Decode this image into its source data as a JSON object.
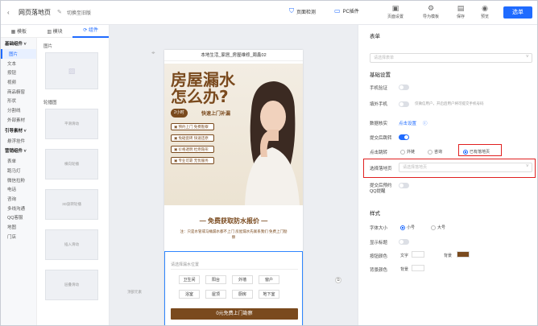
{
  "topbar": {
    "back_icon": "chevron-left-icon",
    "title": "网页落地页",
    "switch_label": "切换至旧版",
    "check_label": "页面检测",
    "pc_label": "PC插件",
    "actions": [
      {
        "label": "页面设置",
        "icon": "page-settings-icon"
      },
      {
        "label": "导为模板",
        "icon": "template-icon"
      },
      {
        "label": "保存",
        "icon": "save-icon"
      },
      {
        "label": "预览",
        "icon": "preview-icon"
      }
    ],
    "publish_label": "选单",
    "accent": "#1f6bff"
  },
  "left_panel": {
    "tabs": [
      "模板",
      "模块",
      "组件"
    ],
    "active_tab": "组件",
    "categories": [
      {
        "group": "基础组件",
        "items": [
          "图片",
          "文本",
          "按钮",
          "视频",
          "商品橱窗",
          "形状",
          "分割线",
          "外部素材"
        ]
      },
      {
        "group": "引导素材",
        "items": [
          "悬浮挂件"
        ]
      },
      {
        "group": "营销组件",
        "items": [
          "表单",
          "跑马灯",
          "微信拉粉",
          "电话",
          "咨询",
          "多线沟通",
          "QQ客服",
          "地图",
          "门店"
        ]
      }
    ],
    "active_item": "图片",
    "widgets": {
      "image_label": "图片",
      "carousel_label": "轮播图",
      "carousel_items": [
        "平滑滑动",
        "横向轮播",
        "3D旋转轮播",
        "插入滑动",
        "层叠滑动"
      ]
    }
  },
  "canvas": {
    "page_title": "本地生活_家居_房屋维修_周鑫02",
    "hero": {
      "headline_line1": "房屋漏水",
      "headline_line2": "怎么办?",
      "pill": "2小时",
      "pill_sub": "快速上门补漏",
      "benefits": [
        "预约上门 免费勘察",
        "免砸瓷砖 快速还原",
        "价格透明 杜绝隐形",
        "专业可靠 无忧服务"
      ]
    },
    "offer": "免费获取防水报价",
    "offer_sub": "注：只是水管或马桶漏水都不上门 房屋漏水先联系我们 免费上门勘察",
    "form": {
      "placeholder": "请选择漏水位置",
      "options": [
        "卫生间",
        "阳台",
        "外墙",
        "窗户",
        "浴室",
        "屋顶",
        "厨房",
        "地下室"
      ],
      "button": "0元免费上门勘察"
    },
    "side_hint": "顶部元素"
  },
  "right_panel": {
    "header": "表单",
    "select_placeholder": "请选择表单",
    "basic_title": "基础设置",
    "phone_verify_label": "手机验证",
    "fill_phone_label": "填外手机",
    "fill_phone_hint": "仅微信用户，开启后用户将可提交手机号码",
    "data_verify_label": "数据核实",
    "data_verify_link": "点击设置",
    "after_submit_label": "提交后跳转",
    "click_jump_label": "点击跳转",
    "jump_options": [
      "外链",
      "咨询",
      "已有落地页"
    ],
    "jump_selected": "已有落地页",
    "select_page_label": "选择落地页",
    "select_page_placeholder": "请选择落地页",
    "qq_label": "提交后预约QQ提醒",
    "style_title": "样式",
    "font_size_label": "字体大小",
    "font_options": [
      "小号",
      "大号"
    ],
    "font_selected": "小号",
    "show_title_label": "显示标题",
    "button_color_label": "按钮颜色",
    "text_label": "文字",
    "bg_label": "背景",
    "bg_color_label": "背景颜色",
    "bg_label2": "背景",
    "button_color": "#7a4a1e",
    "highlight_color": "#e02020"
  }
}
